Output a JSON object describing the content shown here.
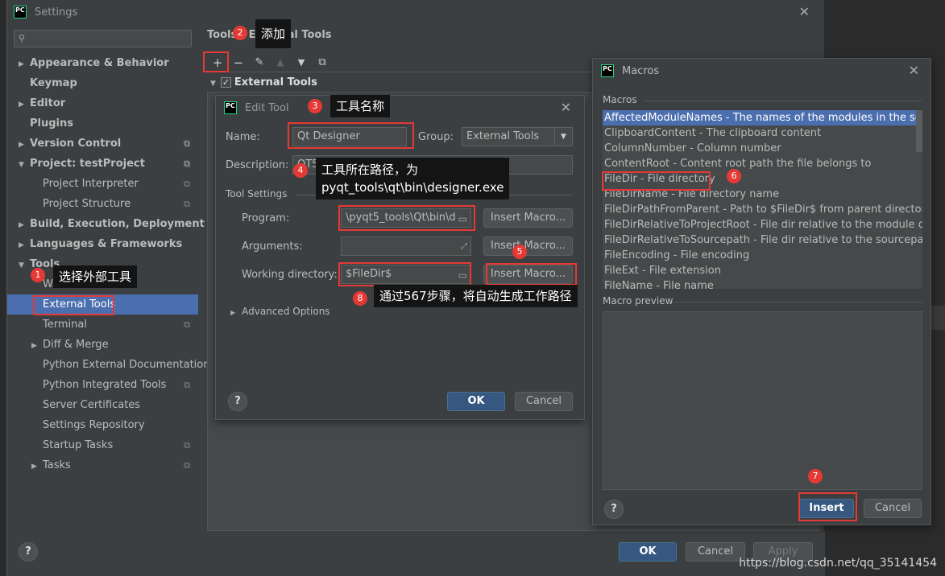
{
  "settings": {
    "title": "Settings",
    "search_placeholder": "",
    "breadcrumb": "Tools › External Tools",
    "sidebar": [
      {
        "label": "Appearance & Behavior",
        "level": 0,
        "arrow": "▶",
        "bold": true
      },
      {
        "label": "Keymap",
        "level": 0,
        "arrow": "",
        "bold": true
      },
      {
        "label": "Editor",
        "level": 0,
        "arrow": "▶",
        "bold": true
      },
      {
        "label": "Plugins",
        "level": 0,
        "arrow": "",
        "bold": true
      },
      {
        "label": "Version Control",
        "level": 0,
        "arrow": "▶",
        "bold": true,
        "copy": true
      },
      {
        "label": "Project: testProject",
        "level": 0,
        "arrow": "▼",
        "bold": true,
        "copy": true
      },
      {
        "label": "Project Interpreter",
        "level": 1,
        "arrow": "",
        "copy": true
      },
      {
        "label": "Project Structure",
        "level": 1,
        "arrow": "",
        "copy": true
      },
      {
        "label": "Build, Execution, Deployment",
        "level": 0,
        "arrow": "▶",
        "bold": true
      },
      {
        "label": "Languages & Frameworks",
        "level": 0,
        "arrow": "▶",
        "bold": true
      },
      {
        "label": "Tools",
        "level": 0,
        "arrow": "▼",
        "bold": true
      },
      {
        "label": "Web Browsers",
        "level": 1,
        "arrow": ""
      },
      {
        "label": "External Tools",
        "level": 1,
        "arrow": "",
        "selected": true
      },
      {
        "label": "Terminal",
        "level": 1,
        "arrow": "",
        "copy": true
      },
      {
        "label": "Diff & Merge",
        "level": 1,
        "arrow": "▶"
      },
      {
        "label": "Python External Documentation",
        "level": 1,
        "arrow": ""
      },
      {
        "label": "Python Integrated Tools",
        "level": 1,
        "arrow": "",
        "copy": true
      },
      {
        "label": "Server Certificates",
        "level": 1,
        "arrow": ""
      },
      {
        "label": "Settings Repository",
        "level": 1,
        "arrow": ""
      },
      {
        "label": "Startup Tasks",
        "level": 1,
        "arrow": "",
        "copy": true
      },
      {
        "label": "Tasks",
        "level": 1,
        "arrow": "▶",
        "copy": true
      }
    ],
    "external_tools_group": "External Tools",
    "buttons": {
      "ok": "OK",
      "cancel": "Cancel",
      "apply": "Apply",
      "help": "?"
    }
  },
  "edit_tool": {
    "title": "Edit Tool",
    "name_label": "Name:",
    "name_value": "Qt Designer",
    "group_label": "Group:",
    "group_value": "External Tools",
    "description_label": "Description:",
    "description_value": "QT5",
    "tool_settings_label": "Tool Settings",
    "program_label": "Program:",
    "program_value": "\\pyqt5_tools\\Qt\\bin\\d",
    "arguments_label": "Arguments:",
    "arguments_value": "",
    "working_dir_label": "Working directory:",
    "working_dir_value": "$FileDir$",
    "insert_macro": "Insert Macro...",
    "advanced_options": "Advanced Options",
    "ok": "OK",
    "cancel": "Cancel",
    "help": "?"
  },
  "macros": {
    "title": "Macros",
    "section_label": "Macros",
    "items": [
      "AffectedModuleNames - The names of the modules in the scope, co",
      "ClipboardContent - The clipboard content",
      "ColumnNumber - Column number",
      "ContentRoot - Content root path the file belongs to",
      "FileDir - File directory",
      "FileDirName - File directory name",
      "FileDirPathFromParent - Path to $FileDir$ from parent directory with",
      "FileDirRelativeToProjectRoot - File dir relative to the module content",
      "FileDirRelativeToSourcepath - File dir relative to the sourcepath root",
      "FileEncoding - File encoding",
      "FileExt - File extension",
      "FileName - File name"
    ],
    "preview_label": "Macro preview",
    "insert": "Insert",
    "cancel": "Cancel",
    "help": "?"
  },
  "annotations": {
    "n1": "1",
    "n2": "2",
    "n3": "3",
    "n4": "4",
    "n5": "5",
    "n6": "6",
    "n7": "7",
    "n8": "8",
    "c1": "选择外部工具",
    "c2": "添加",
    "c3": "工具名称",
    "c4_line1": "工具所在路径，为",
    "c4_line2": "pyqt_tools\\qt\\bin\\designer.exe",
    "c8": "通过567步骤，将自动生成工作路径"
  },
  "watermark": "https://blog.csdn.net/qq_35141454",
  "colors": {
    "accent": "#4b6eaf",
    "annotation_red": "#e53935",
    "background": "#3c3f41"
  }
}
